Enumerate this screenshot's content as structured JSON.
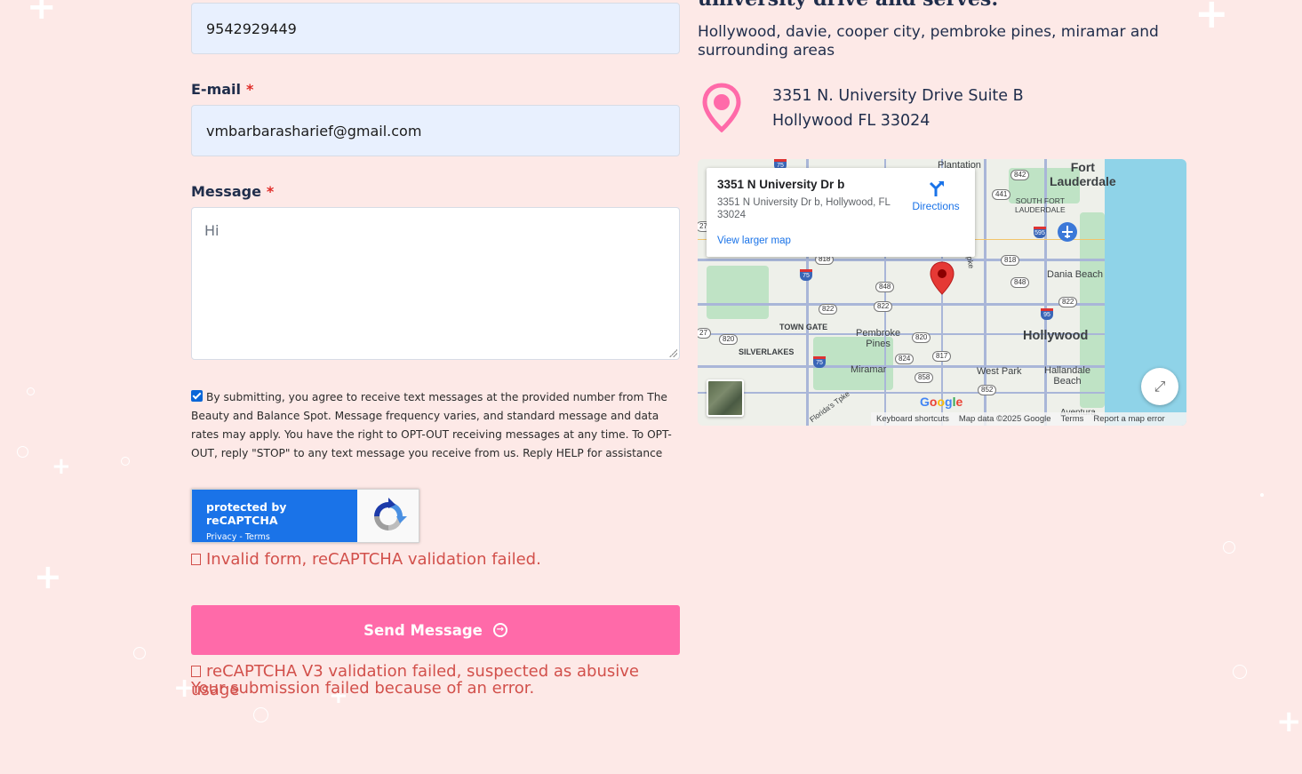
{
  "form": {
    "phone_value": "9542929449",
    "email_label": "E-mail",
    "email_value": "vmbarbarasharief@gmail.com",
    "message_label": "Message",
    "message_value": "Hi",
    "required_mark": "*",
    "consent_checked": true,
    "consent_text": "By submitting, you agree to receive text messages at the provided number from The Beauty and Balance Spot. Message frequency varies, and standard message and data rates may apply. You have the right to OPT-OUT receiving messages at any time. To OPT-OUT, reply \"STOP\" to any text message you receive from us. Reply HELP for assistance",
    "recaptcha_title": "protected by reCAPTCHA",
    "recaptcha_links": "Privacy - Terms",
    "error_invalid": "Invalid form, reCAPTCHA validation failed.",
    "send_label": "Send Message",
    "error_v3": "reCAPTCHA V3 validation failed, suspected as abusive usage",
    "error_submission": "Your submission failed because of an error."
  },
  "location": {
    "heading_partial": "university drive and serves:",
    "serves_text": "Hollywood, davie, cooper city, pembroke pines, miramar  and surrounding areas",
    "address_line1": "3351 N. University Drive Suite B",
    "address_line2": "Hollywood FL 33024"
  },
  "map": {
    "card_title": "3351 N University Dr b",
    "card_address": "3351 N University Dr b, Hollywood, FL 33024",
    "directions_label": "Directions",
    "view_larger": "View larger map",
    "google_logo": "Google",
    "keyboard_shortcuts": "Keyboard shortcuts",
    "map_data": "Map data ©2025 Google",
    "terms": "Terms",
    "report": "Report a map error",
    "labels": {
      "plantation": "Plantation",
      "fort_lauderdale": "Fort\nLauderdale",
      "south_fort_lauderdale": "SOUTH FORT\nLAUDERDALE",
      "dania_beach": "Dania Beach",
      "town_gate": "TOWN GATE",
      "pembroke_pines": "Pembroke\nPines",
      "hollywood": "Hollywood",
      "silverlakes": "SILVERLAKES",
      "miramar": "Miramar",
      "west_park": "West Park",
      "hallandale_beach": "Hallandale\nBeach",
      "aventura": "Aventura",
      "floridas_tpke_a": "Florida's Tpke",
      "floridas_tpke_b": "Florida's Tpke"
    },
    "shields": [
      "75",
      "842",
      "441",
      "595",
      "818",
      "818",
      "848",
      "848",
      "822",
      "822",
      "822",
      "95",
      "820",
      "820",
      "824",
      "858",
      "817",
      "852",
      "75",
      "75",
      "27",
      "27"
    ]
  },
  "colors": {
    "background": "#fde9e7",
    "accent_pink": "#ff6aa9",
    "error_red": "#d2504b",
    "input_fill": "#e8f0fe",
    "recaptcha_blue": "#1a73e8"
  }
}
